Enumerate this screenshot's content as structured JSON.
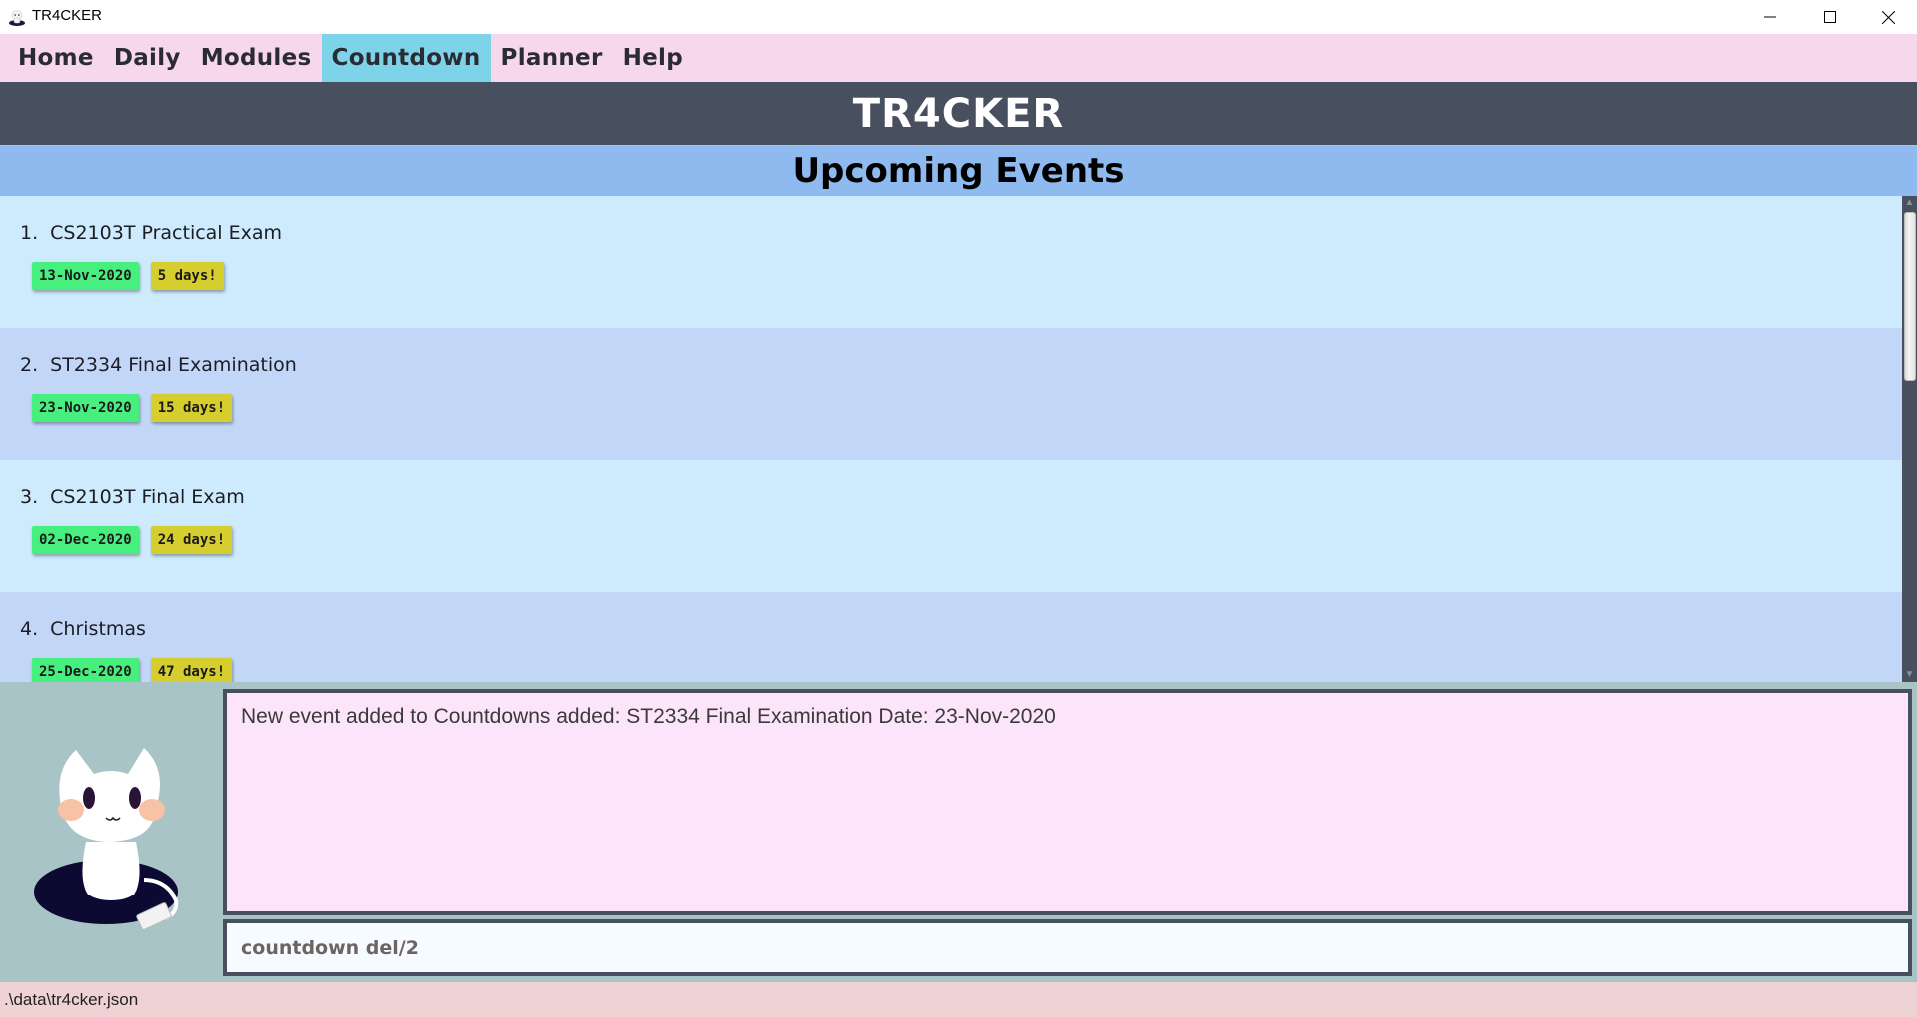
{
  "window": {
    "title": "TR4CKER",
    "controls": [
      "minimize",
      "maximize",
      "close"
    ]
  },
  "menu": {
    "items": [
      {
        "label": "Home",
        "active": false
      },
      {
        "label": "Daily",
        "active": false
      },
      {
        "label": "Modules",
        "active": false
      },
      {
        "label": "Countdown",
        "active": true
      },
      {
        "label": "Planner",
        "active": false
      },
      {
        "label": "Help",
        "active": false
      }
    ]
  },
  "header": {
    "title": "TR4CKER"
  },
  "section": {
    "title": "Upcoming Events"
  },
  "events": [
    {
      "index": "1.",
      "name": "CS2103T Practical Exam",
      "date": "13-Nov-2020",
      "countdown": "5 days!"
    },
    {
      "index": "2.",
      "name": "ST2334 Final Examination",
      "date": "23-Nov-2020",
      "countdown": "15 days!"
    },
    {
      "index": "3.",
      "name": "CS2103T Final Exam",
      "date": "02-Dec-2020",
      "countdown": "24 days!"
    },
    {
      "index": "4.",
      "name": "Christmas",
      "date": "25-Dec-2020",
      "countdown": "47 days!"
    }
  ],
  "result": {
    "message": "New event added to Countdowns added: ST2334 Final Examination Date: 23-Nov-2020"
  },
  "command": {
    "value": "countdown del/2"
  },
  "status": {
    "file_path": ".\\data\\tr4cker.json"
  },
  "colors": {
    "menu_bg": "#f6d7ec",
    "menu_active": "#7dd4e9",
    "header_bg": "#48505f",
    "section_bg": "#8fbaef",
    "card_odd": "#cdebfc",
    "card_even": "#c2d7f8",
    "date_tag": "#47f07e",
    "days_tag": "#d6cd2e",
    "bottom_bg": "#a8c4c6",
    "result_bg": "#fce4fa",
    "status_bg": "#efd2d4"
  }
}
